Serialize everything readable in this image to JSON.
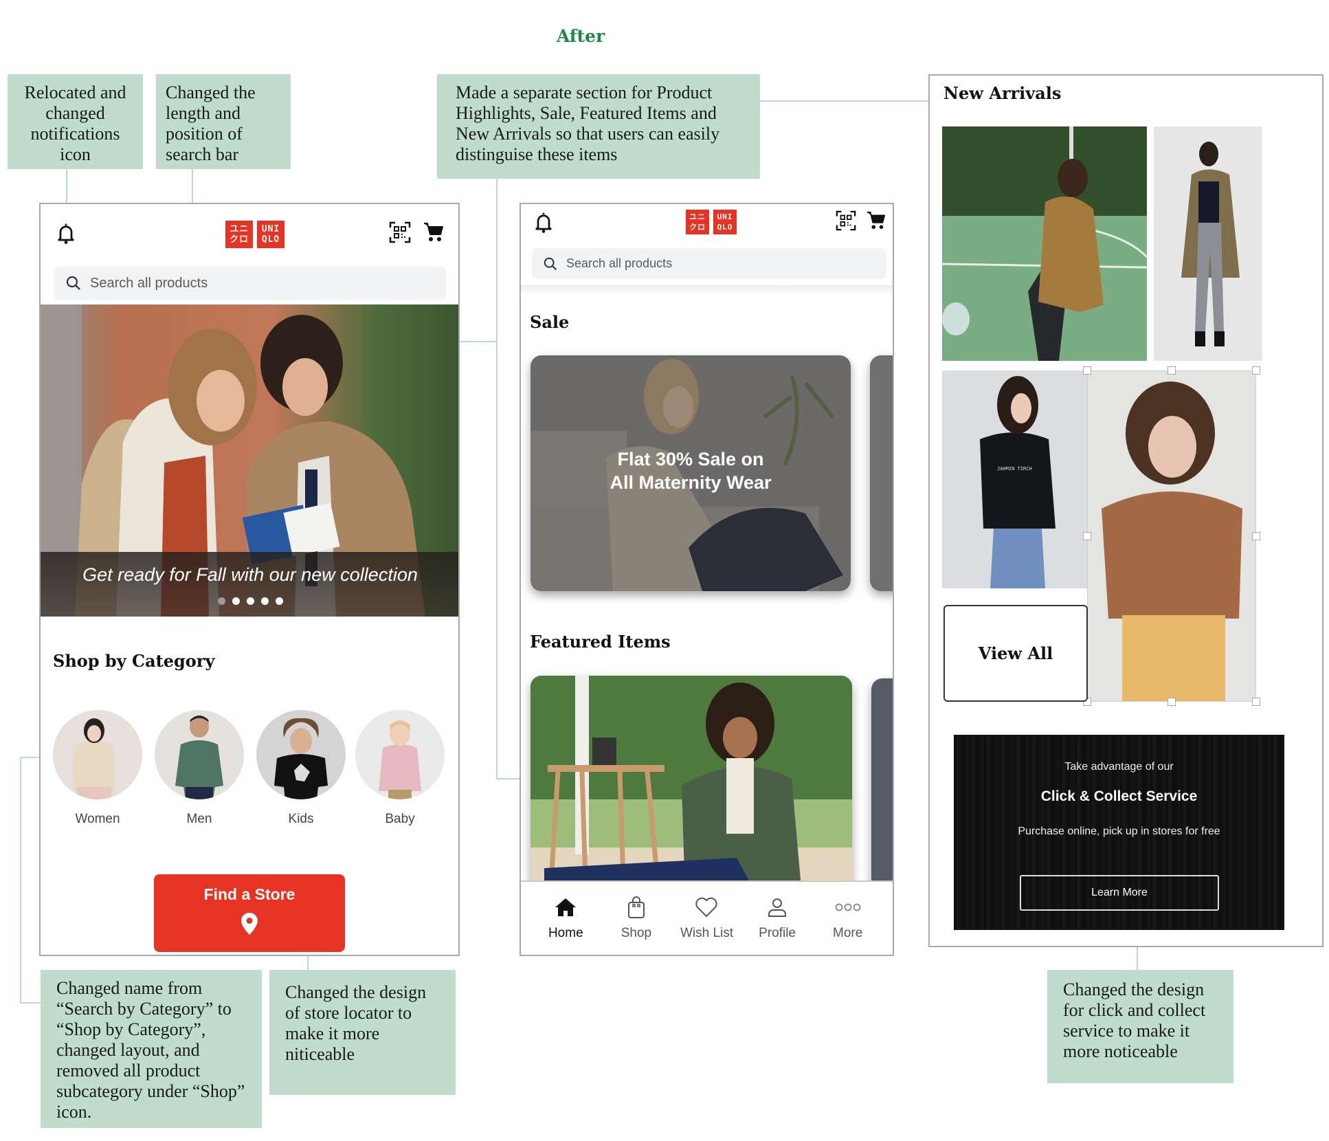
{
  "page_title": "After",
  "colors": {
    "brand_red": "#e73323",
    "annotation_bg": "#bfdccd",
    "connector": "#b6dccb",
    "title_green": "#1a8a45"
  },
  "annotations": {
    "notifications": "Relocated and changed notifications icon",
    "search_bar": "Changed the length and position of search bar",
    "sections": "Made a separate section for Product Highlights, Sale, Featured Items and New Arrivals so that users can easily distinguise these items",
    "category": "Changed name from “Search by Category” to “Shop by Category”, changed layout, and removed all product subcategory under “Shop” icon.",
    "store_locator": "Changed the design of store locator to make it more niticeable",
    "click_collect": "Changed the design for click and collect service to make it more noticeable"
  },
  "phone1": {
    "logo": {
      "left": "ユニ クロ",
      "right": "UNI QLO"
    },
    "icons": {
      "notifications": "bell-icon",
      "scan": "qr-code-icon",
      "cart": "cart-icon",
      "search": "search-icon",
      "store": "map-pin-icon"
    },
    "search_placeholder": "Search all products",
    "hero_caption": "Get ready for Fall with our new collection",
    "carousel": {
      "total": 5,
      "active_index": 0
    },
    "section_title": "Shop by Category",
    "categories": [
      {
        "label": "Women"
      },
      {
        "label": "Men"
      },
      {
        "label": "Kids"
      },
      {
        "label": "Baby"
      }
    ],
    "store_button": "Find a Store"
  },
  "phone2": {
    "search_placeholder": "Search all products",
    "sale_title": "Sale",
    "sale_card_text_line1": "Flat 30% Sale on",
    "sale_card_text_line2": "All Maternity Wear",
    "featured_title": "Featured Items",
    "tabs": [
      {
        "label": "Home",
        "icon": "home-icon",
        "active": true
      },
      {
        "label": "Shop",
        "icon": "shopping-bag-icon",
        "active": false
      },
      {
        "label": "Wish List",
        "icon": "heart-icon",
        "active": false
      },
      {
        "label": "Profile",
        "icon": "user-icon",
        "active": false
      },
      {
        "label": "More",
        "icon": "more-dots-icon",
        "active": false
      }
    ]
  },
  "new_arrivals": {
    "title": "New Arrivals",
    "view_all": "View All",
    "click_collect": {
      "line1": "Take advantage of our",
      "line2": "Click & Collect Service",
      "line3": "Purchase online, pick up in stores for free",
      "button": "Learn More"
    }
  }
}
